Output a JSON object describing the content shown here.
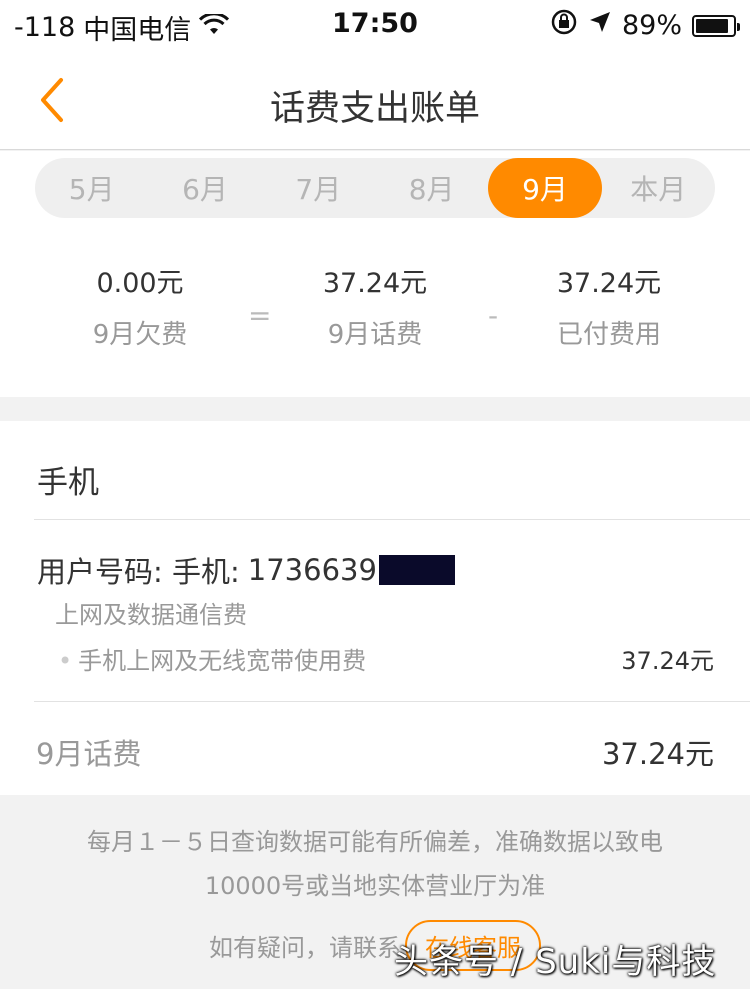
{
  "status_bar": {
    "signal": "-118",
    "carrier": "中国电信",
    "time": "17:50",
    "battery_percent": "89%",
    "battery_level": 0.89
  },
  "nav": {
    "title": "话费支出账单",
    "back_icon": "chevron-left-icon",
    "accent": "#ff8a00"
  },
  "month_tabs": [
    {
      "label": "5月",
      "active": false
    },
    {
      "label": "6月",
      "active": false
    },
    {
      "label": "7月",
      "active": false
    },
    {
      "label": "8月",
      "active": false
    },
    {
      "label": "9月",
      "active": true
    },
    {
      "label": "本月",
      "active": false
    }
  ],
  "summary": {
    "arrears": {
      "amount": "0.00元",
      "label": "9月欠费"
    },
    "equals": "=",
    "charges": {
      "amount": "37.24元",
      "label": "9月话费"
    },
    "minus": "-",
    "paid": {
      "amount": "37.24元",
      "label": "已付费用"
    }
  },
  "detail": {
    "section_title": "手机",
    "user_label": "用户号码:  手机:",
    "phone_partial": "1736639",
    "category": "上网及数据通信费",
    "item": {
      "name": "手机上网及无线宽带使用费",
      "value": "37.24元"
    },
    "total_label": "9月话费",
    "total_value": "37.24元"
  },
  "footer": {
    "notice_line1": "每月１－５日查询数据可能有所偏差，准确数据以致电",
    "notice_line2": "10000号或当地实体营业厅为准",
    "contact_text": "如有疑问，请联系",
    "online_service": "在线客服"
  },
  "watermark": "头条号 / Suki与科技"
}
